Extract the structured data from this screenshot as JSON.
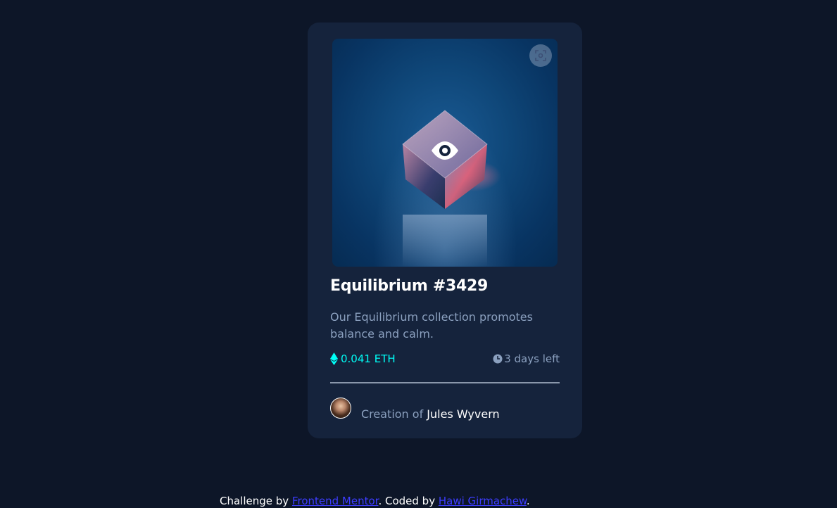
{
  "card": {
    "title": "Equilibrium #3429",
    "description": "Our Equilibrium collection promotes balance and calm.",
    "price": "0.041 ETH",
    "time_left": "3 days left",
    "creator_prefix": "Creation of",
    "creator_name": "Jules Wyvern",
    "image_alt": "Equilibrium cube NFT artwork"
  },
  "footer": {
    "prefix": "Challenge by",
    "challenge_link": "Frontend Mentor",
    "middle": ". Coded by",
    "author_link": "Hawi Girmachew",
    "suffix": "."
  },
  "colors": {
    "background": "#0d1628",
    "card": "#15233c",
    "cyan": "#00fff7",
    "soft_blue": "#8ba0bf",
    "white": "#ffffff",
    "link": "#3d3dff"
  },
  "icons": [
    "fullscreen-icon",
    "eye-icon",
    "ethereum-icon",
    "clock-icon"
  ]
}
